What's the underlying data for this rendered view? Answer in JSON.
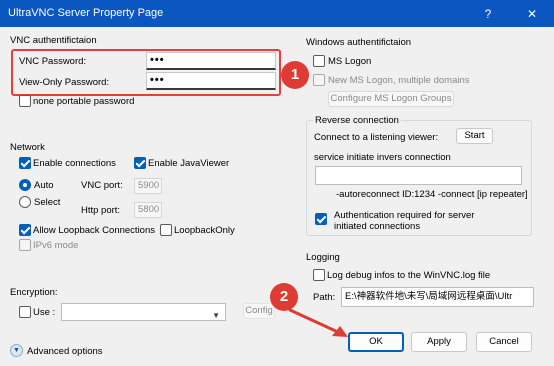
{
  "window": {
    "title": "UltraVNC Server Property Page",
    "help_glyph": "?",
    "close_glyph": "✕"
  },
  "vnc_auth": {
    "heading": "VNC authentifictaion",
    "vnc_password_label": "VNC Password:",
    "vnc_password_value": "•••",
    "viewonly_password_label": "View-Only Password:",
    "viewonly_password_value": "•••",
    "none_portable_label": "none portable password",
    "none_portable_checked": false
  },
  "windows_auth": {
    "heading": "Windows authentifictaion",
    "ms_logon_label": "MS Logon",
    "ms_logon_checked": false,
    "new_ms_logon_label": "New MS Logon, multiple domains",
    "configure_button": "Configure MS Logon Groups"
  },
  "network": {
    "heading": "Network",
    "enable_connections_label": "Enable connections",
    "enable_connections_checked": true,
    "enable_javaviewer_label": "Enable JavaViewer",
    "enable_javaviewer_checked": true,
    "auto_label": "Auto",
    "select_label": "Select",
    "auto_selected": true,
    "vnc_port_label": "VNC port:",
    "vnc_port_value": "5900",
    "http_port_label": "Http port:",
    "http_port_value": "5800",
    "allow_loopback_label": "Allow Loopback Connections",
    "allow_loopback_checked": true,
    "loopback_only_label": "LoopbackOnly",
    "loopback_only_checked": false,
    "ipv6_label": "IPv6 mode"
  },
  "reverse": {
    "heading": "Reverse connection",
    "connect_label": "Connect to a listening viewer:",
    "start_button": "Start",
    "service_label": "service initiate invers connection",
    "service_value": "",
    "autoreconnect_text": "-autoreconnect ID:1234 -connect [ip repeater]",
    "auth_required_label": "Authentication required for server initiated connections",
    "auth_required_line1": "Authentication required for server",
    "auth_required_line2": "initiated connections",
    "auth_required_checked": true
  },
  "logging": {
    "heading": "Logging",
    "log_debug_label": "Log debug infos to the WinVNC.log file",
    "log_debug_checked": false,
    "path_label": "Path:",
    "path_value": "E:\\神器软件地\\未写\\局域网远程桌面\\Ultr"
  },
  "encryption": {
    "heading": "Encryption:",
    "use_label": "Use :",
    "use_checked": false,
    "combo_value": "",
    "config_button": "Config"
  },
  "advanced": {
    "label": "Advanced options"
  },
  "buttons": {
    "ok": "OK",
    "apply": "Apply",
    "cancel": "Cancel"
  },
  "annotations": {
    "badge1": "1",
    "badge2": "2",
    "color": "#dd3b34"
  },
  "colors": {
    "titlebar": "#0a57c2",
    "accent": "#005fb8",
    "background": "#f0f0f0"
  }
}
